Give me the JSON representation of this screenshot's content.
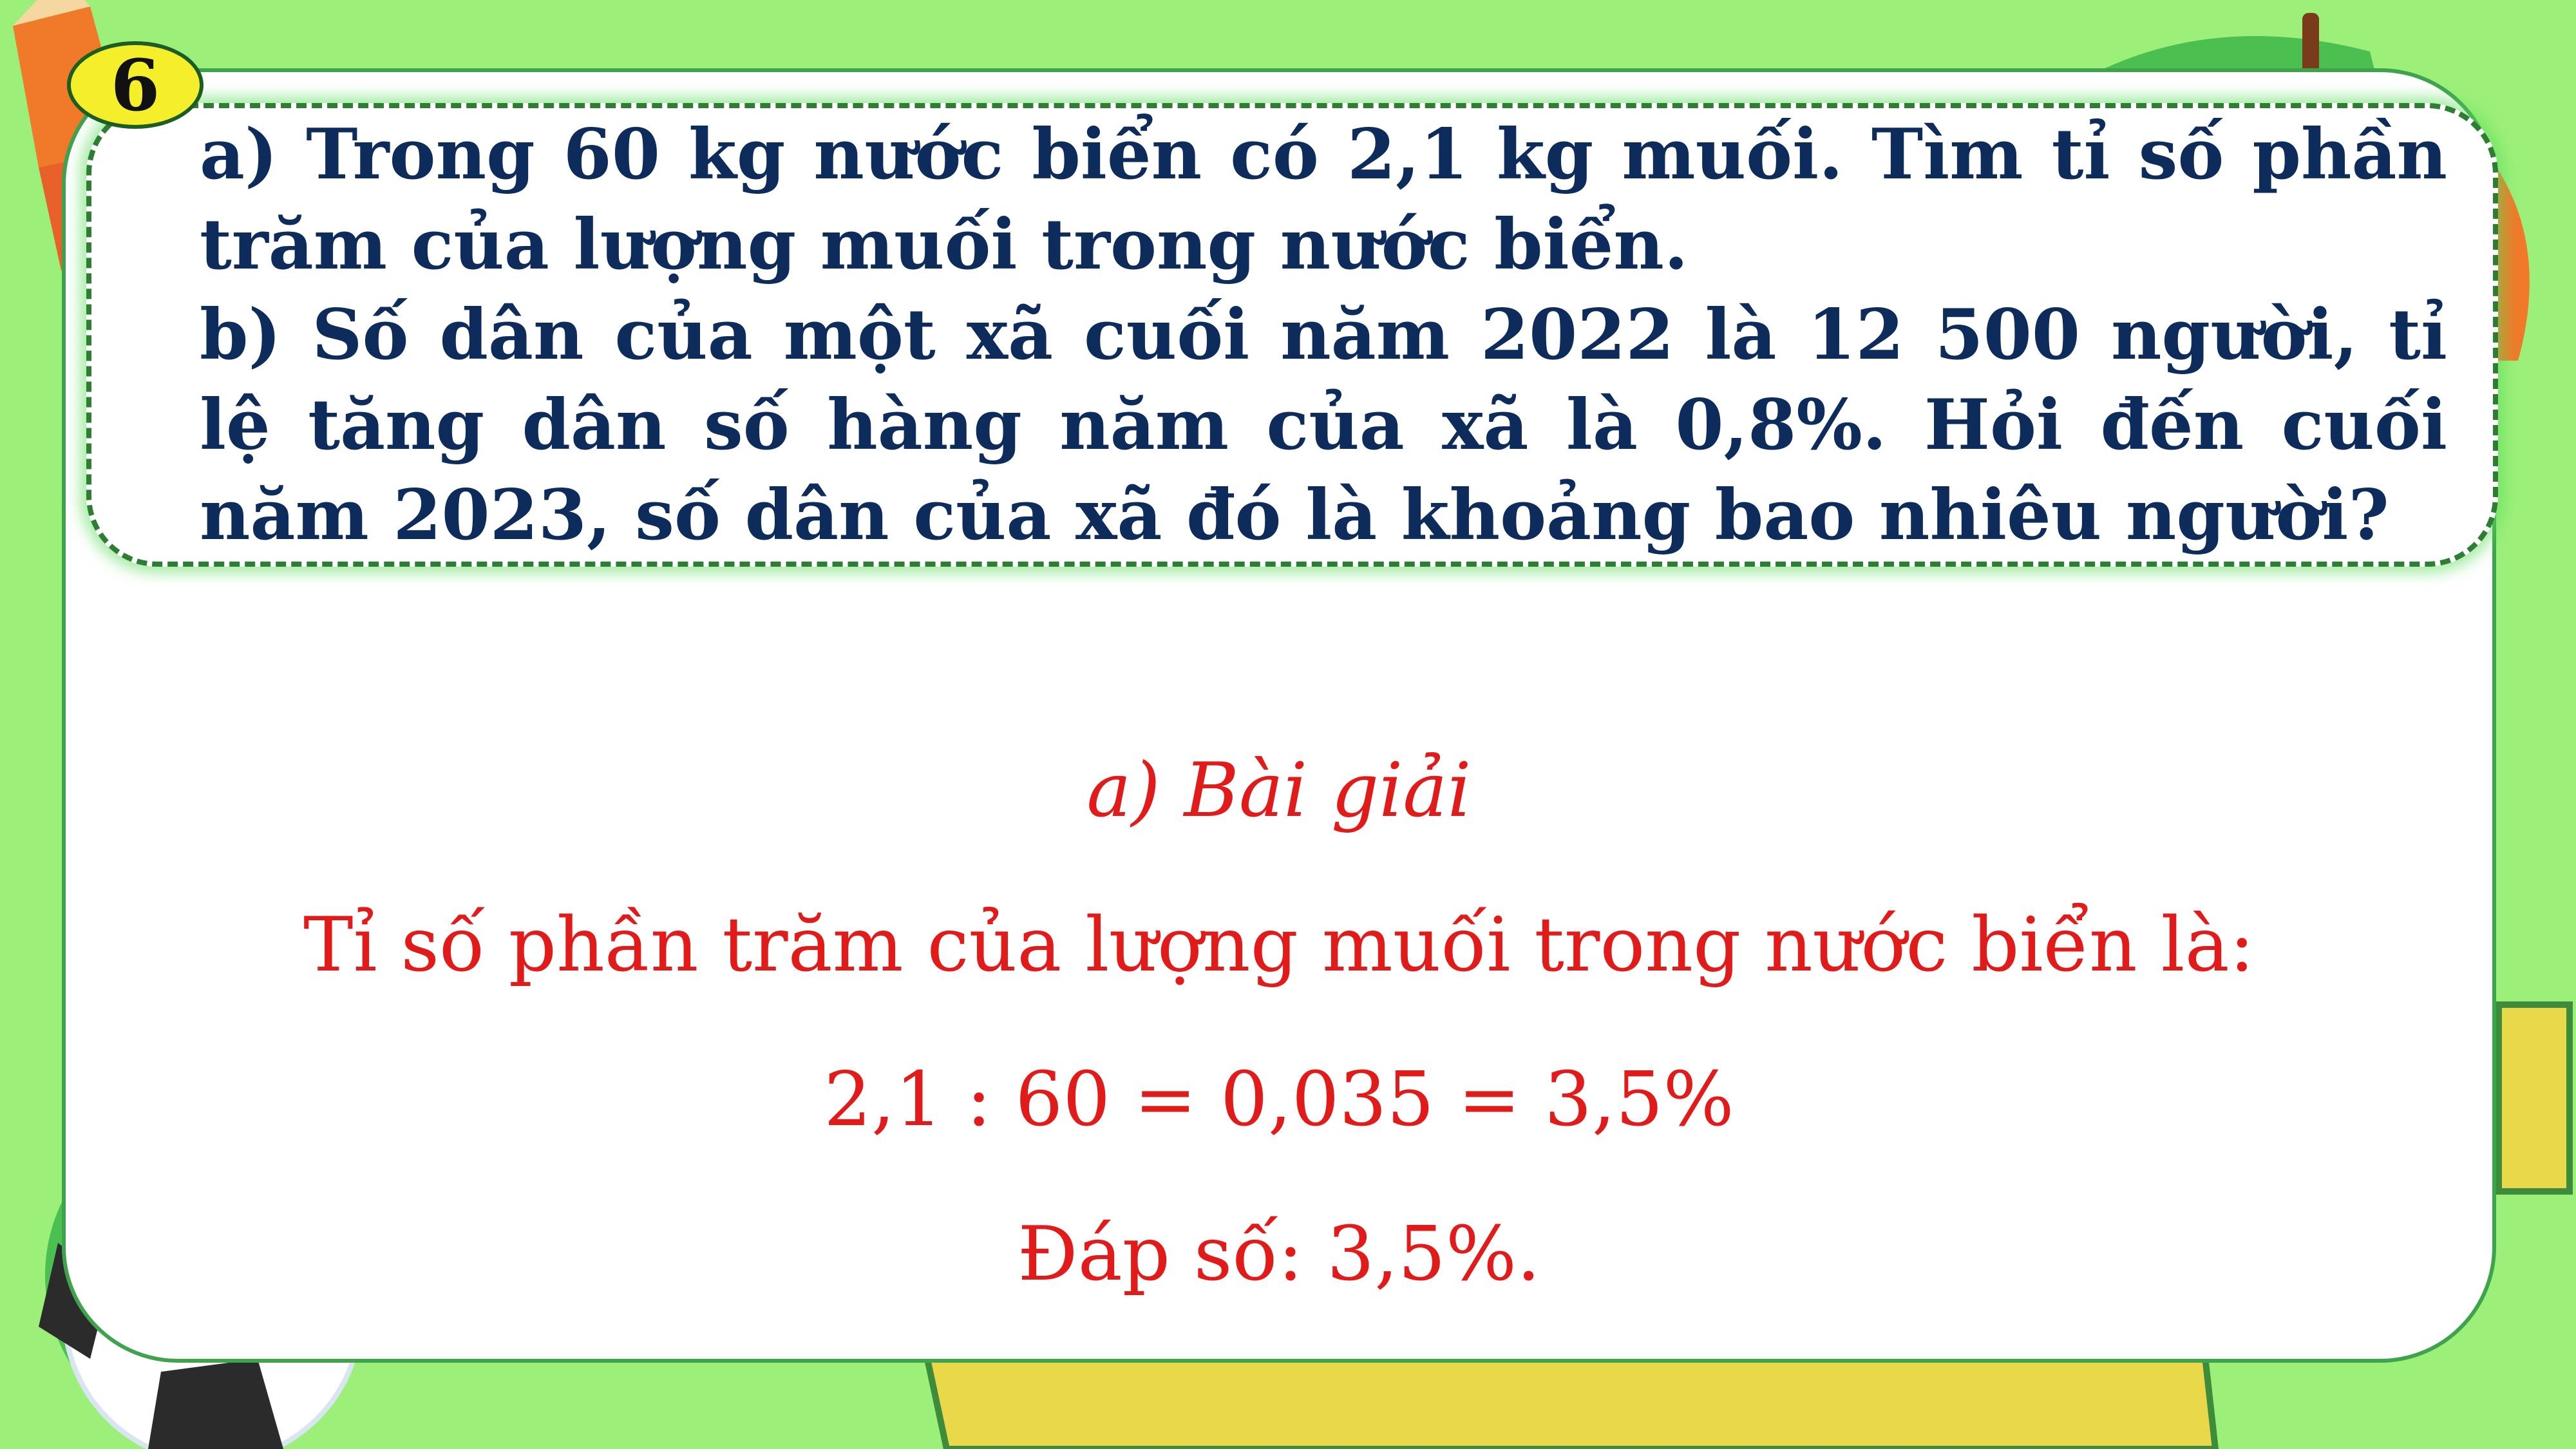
{
  "problem": {
    "number": "6",
    "part_a": "a) Trong 60 kg nước biển có 2,1 kg muối. Tìm tỉ số phần trăm của lượng muối trong nước biển.",
    "part_b": "b) Số dân của một xã cuối năm 2022 là 12 500 người, tỉ lệ tăng dân số hàng năm của xã là 0,8%. Hỏi đến cuối năm 2023, số dân của xã đó là khoảng bao nhiêu người?"
  },
  "solution": {
    "title": "a) Bài giải",
    "statement": "Tỉ số phần trăm của lượng muối trong nước biển là:",
    "calculation": "2,1 : 60 = 0,035 = 3,5%",
    "answer": "Đáp số: 3,5%."
  },
  "colors": {
    "background": "#9cf07a",
    "question_text": "#0d2c5c",
    "solution_text": "#e11a1a",
    "badge": "#f4ef2a",
    "border": "#2e7d32"
  },
  "decorations": [
    "pencil-icon",
    "soccer-ball-icon",
    "ruler-icon",
    "leaf-icon"
  ]
}
